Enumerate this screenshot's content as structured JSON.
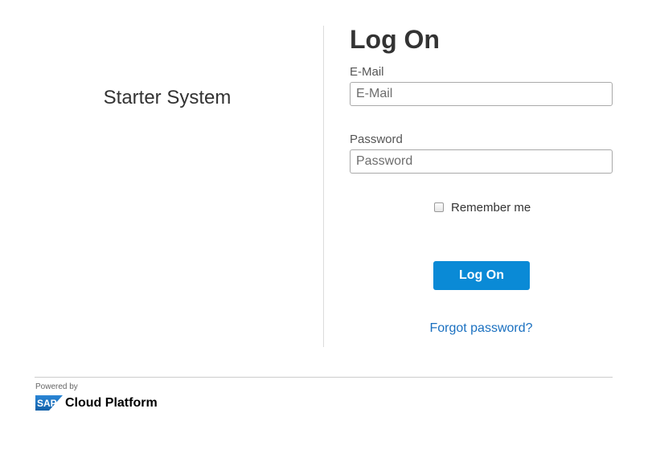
{
  "left": {
    "system_name": "Starter System"
  },
  "form": {
    "title": "Log On",
    "email_label": "E-Mail",
    "email_placeholder": "E-Mail",
    "email_value": "",
    "password_label": "Password",
    "password_placeholder": "Password",
    "password_value": "",
    "remember_label": "Remember me",
    "remember_checked": false,
    "submit_label": "Log On",
    "forgot_label": "Forgot password?"
  },
  "footer": {
    "powered_by": "Powered by",
    "logo_text": "SAP",
    "platform_name": "Cloud Platform"
  },
  "colors": {
    "button": "#0a8ad6",
    "link": "#1a70c0",
    "logo_blue": "#1a6fbf"
  },
  "icons": {
    "logo": "sap-logo-icon",
    "checkbox": "checkbox-icon"
  }
}
